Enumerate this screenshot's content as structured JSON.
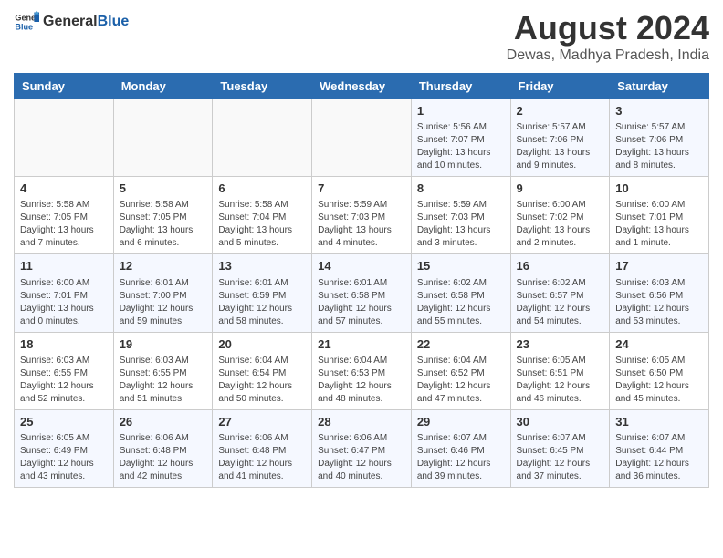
{
  "header": {
    "logo_general": "General",
    "logo_blue": "Blue",
    "title": "August 2024",
    "subtitle": "Dewas, Madhya Pradesh, India"
  },
  "weekdays": [
    "Sunday",
    "Monday",
    "Tuesday",
    "Wednesday",
    "Thursday",
    "Friday",
    "Saturday"
  ],
  "weeks": [
    [
      {
        "day": "",
        "info": ""
      },
      {
        "day": "",
        "info": ""
      },
      {
        "day": "",
        "info": ""
      },
      {
        "day": "",
        "info": ""
      },
      {
        "day": "1",
        "info": "Sunrise: 5:56 AM\nSunset: 7:07 PM\nDaylight: 13 hours\nand 10 minutes."
      },
      {
        "day": "2",
        "info": "Sunrise: 5:57 AM\nSunset: 7:06 PM\nDaylight: 13 hours\nand 9 minutes."
      },
      {
        "day": "3",
        "info": "Sunrise: 5:57 AM\nSunset: 7:06 PM\nDaylight: 13 hours\nand 8 minutes."
      }
    ],
    [
      {
        "day": "4",
        "info": "Sunrise: 5:58 AM\nSunset: 7:05 PM\nDaylight: 13 hours\nand 7 minutes."
      },
      {
        "day": "5",
        "info": "Sunrise: 5:58 AM\nSunset: 7:05 PM\nDaylight: 13 hours\nand 6 minutes."
      },
      {
        "day": "6",
        "info": "Sunrise: 5:58 AM\nSunset: 7:04 PM\nDaylight: 13 hours\nand 5 minutes."
      },
      {
        "day": "7",
        "info": "Sunrise: 5:59 AM\nSunset: 7:03 PM\nDaylight: 13 hours\nand 4 minutes."
      },
      {
        "day": "8",
        "info": "Sunrise: 5:59 AM\nSunset: 7:03 PM\nDaylight: 13 hours\nand 3 minutes."
      },
      {
        "day": "9",
        "info": "Sunrise: 6:00 AM\nSunset: 7:02 PM\nDaylight: 13 hours\nand 2 minutes."
      },
      {
        "day": "10",
        "info": "Sunrise: 6:00 AM\nSunset: 7:01 PM\nDaylight: 13 hours\nand 1 minute."
      }
    ],
    [
      {
        "day": "11",
        "info": "Sunrise: 6:00 AM\nSunset: 7:01 PM\nDaylight: 13 hours\nand 0 minutes."
      },
      {
        "day": "12",
        "info": "Sunrise: 6:01 AM\nSunset: 7:00 PM\nDaylight: 12 hours\nand 59 minutes."
      },
      {
        "day": "13",
        "info": "Sunrise: 6:01 AM\nSunset: 6:59 PM\nDaylight: 12 hours\nand 58 minutes."
      },
      {
        "day": "14",
        "info": "Sunrise: 6:01 AM\nSunset: 6:58 PM\nDaylight: 12 hours\nand 57 minutes."
      },
      {
        "day": "15",
        "info": "Sunrise: 6:02 AM\nSunset: 6:58 PM\nDaylight: 12 hours\nand 55 minutes."
      },
      {
        "day": "16",
        "info": "Sunrise: 6:02 AM\nSunset: 6:57 PM\nDaylight: 12 hours\nand 54 minutes."
      },
      {
        "day": "17",
        "info": "Sunrise: 6:03 AM\nSunset: 6:56 PM\nDaylight: 12 hours\nand 53 minutes."
      }
    ],
    [
      {
        "day": "18",
        "info": "Sunrise: 6:03 AM\nSunset: 6:55 PM\nDaylight: 12 hours\nand 52 minutes."
      },
      {
        "day": "19",
        "info": "Sunrise: 6:03 AM\nSunset: 6:55 PM\nDaylight: 12 hours\nand 51 minutes."
      },
      {
        "day": "20",
        "info": "Sunrise: 6:04 AM\nSunset: 6:54 PM\nDaylight: 12 hours\nand 50 minutes."
      },
      {
        "day": "21",
        "info": "Sunrise: 6:04 AM\nSunset: 6:53 PM\nDaylight: 12 hours\nand 48 minutes."
      },
      {
        "day": "22",
        "info": "Sunrise: 6:04 AM\nSunset: 6:52 PM\nDaylight: 12 hours\nand 47 minutes."
      },
      {
        "day": "23",
        "info": "Sunrise: 6:05 AM\nSunset: 6:51 PM\nDaylight: 12 hours\nand 46 minutes."
      },
      {
        "day": "24",
        "info": "Sunrise: 6:05 AM\nSunset: 6:50 PM\nDaylight: 12 hours\nand 45 minutes."
      }
    ],
    [
      {
        "day": "25",
        "info": "Sunrise: 6:05 AM\nSunset: 6:49 PM\nDaylight: 12 hours\nand 43 minutes."
      },
      {
        "day": "26",
        "info": "Sunrise: 6:06 AM\nSunset: 6:48 PM\nDaylight: 12 hours\nand 42 minutes."
      },
      {
        "day": "27",
        "info": "Sunrise: 6:06 AM\nSunset: 6:48 PM\nDaylight: 12 hours\nand 41 minutes."
      },
      {
        "day": "28",
        "info": "Sunrise: 6:06 AM\nSunset: 6:47 PM\nDaylight: 12 hours\nand 40 minutes."
      },
      {
        "day": "29",
        "info": "Sunrise: 6:07 AM\nSunset: 6:46 PM\nDaylight: 12 hours\nand 39 minutes."
      },
      {
        "day": "30",
        "info": "Sunrise: 6:07 AM\nSunset: 6:45 PM\nDaylight: 12 hours\nand 37 minutes."
      },
      {
        "day": "31",
        "info": "Sunrise: 6:07 AM\nSunset: 6:44 PM\nDaylight: 12 hours\nand 36 minutes."
      }
    ]
  ]
}
